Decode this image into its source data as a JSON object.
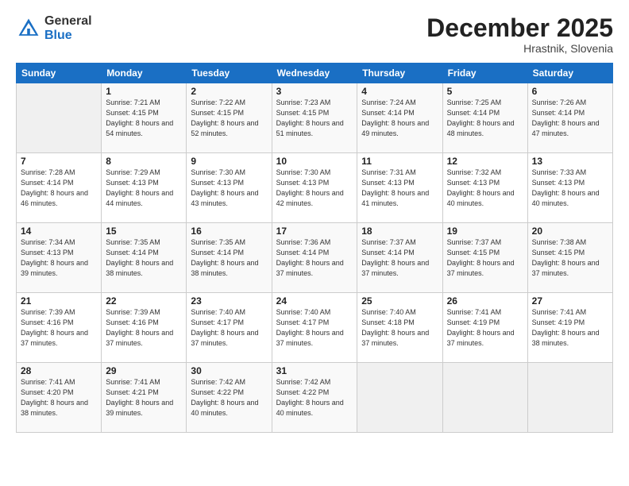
{
  "logo": {
    "general": "General",
    "blue": "Blue"
  },
  "header": {
    "month": "December 2025",
    "location": "Hrastnik, Slovenia"
  },
  "weekdays": [
    "Sunday",
    "Monday",
    "Tuesday",
    "Wednesday",
    "Thursday",
    "Friday",
    "Saturday"
  ],
  "weeks": [
    [
      {
        "day": "",
        "sunrise": "",
        "sunset": "",
        "daylight": ""
      },
      {
        "day": "1",
        "sunrise": "Sunrise: 7:21 AM",
        "sunset": "Sunset: 4:15 PM",
        "daylight": "Daylight: 8 hours and 54 minutes."
      },
      {
        "day": "2",
        "sunrise": "Sunrise: 7:22 AM",
        "sunset": "Sunset: 4:15 PM",
        "daylight": "Daylight: 8 hours and 52 minutes."
      },
      {
        "day": "3",
        "sunrise": "Sunrise: 7:23 AM",
        "sunset": "Sunset: 4:15 PM",
        "daylight": "Daylight: 8 hours and 51 minutes."
      },
      {
        "day": "4",
        "sunrise": "Sunrise: 7:24 AM",
        "sunset": "Sunset: 4:14 PM",
        "daylight": "Daylight: 8 hours and 49 minutes."
      },
      {
        "day": "5",
        "sunrise": "Sunrise: 7:25 AM",
        "sunset": "Sunset: 4:14 PM",
        "daylight": "Daylight: 8 hours and 48 minutes."
      },
      {
        "day": "6",
        "sunrise": "Sunrise: 7:26 AM",
        "sunset": "Sunset: 4:14 PM",
        "daylight": "Daylight: 8 hours and 47 minutes."
      }
    ],
    [
      {
        "day": "7",
        "sunrise": "Sunrise: 7:28 AM",
        "sunset": "Sunset: 4:14 PM",
        "daylight": "Daylight: 8 hours and 46 minutes."
      },
      {
        "day": "8",
        "sunrise": "Sunrise: 7:29 AM",
        "sunset": "Sunset: 4:13 PM",
        "daylight": "Daylight: 8 hours and 44 minutes."
      },
      {
        "day": "9",
        "sunrise": "Sunrise: 7:30 AM",
        "sunset": "Sunset: 4:13 PM",
        "daylight": "Daylight: 8 hours and 43 minutes."
      },
      {
        "day": "10",
        "sunrise": "Sunrise: 7:30 AM",
        "sunset": "Sunset: 4:13 PM",
        "daylight": "Daylight: 8 hours and 42 minutes."
      },
      {
        "day": "11",
        "sunrise": "Sunrise: 7:31 AM",
        "sunset": "Sunset: 4:13 PM",
        "daylight": "Daylight: 8 hours and 41 minutes."
      },
      {
        "day": "12",
        "sunrise": "Sunrise: 7:32 AM",
        "sunset": "Sunset: 4:13 PM",
        "daylight": "Daylight: 8 hours and 40 minutes."
      },
      {
        "day": "13",
        "sunrise": "Sunrise: 7:33 AM",
        "sunset": "Sunset: 4:13 PM",
        "daylight": "Daylight: 8 hours and 40 minutes."
      }
    ],
    [
      {
        "day": "14",
        "sunrise": "Sunrise: 7:34 AM",
        "sunset": "Sunset: 4:13 PM",
        "daylight": "Daylight: 8 hours and 39 minutes."
      },
      {
        "day": "15",
        "sunrise": "Sunrise: 7:35 AM",
        "sunset": "Sunset: 4:14 PM",
        "daylight": "Daylight: 8 hours and 38 minutes."
      },
      {
        "day": "16",
        "sunrise": "Sunrise: 7:35 AM",
        "sunset": "Sunset: 4:14 PM",
        "daylight": "Daylight: 8 hours and 38 minutes."
      },
      {
        "day": "17",
        "sunrise": "Sunrise: 7:36 AM",
        "sunset": "Sunset: 4:14 PM",
        "daylight": "Daylight: 8 hours and 37 minutes."
      },
      {
        "day": "18",
        "sunrise": "Sunrise: 7:37 AM",
        "sunset": "Sunset: 4:14 PM",
        "daylight": "Daylight: 8 hours and 37 minutes."
      },
      {
        "day": "19",
        "sunrise": "Sunrise: 7:37 AM",
        "sunset": "Sunset: 4:15 PM",
        "daylight": "Daylight: 8 hours and 37 minutes."
      },
      {
        "day": "20",
        "sunrise": "Sunrise: 7:38 AM",
        "sunset": "Sunset: 4:15 PM",
        "daylight": "Daylight: 8 hours and 37 minutes."
      }
    ],
    [
      {
        "day": "21",
        "sunrise": "Sunrise: 7:39 AM",
        "sunset": "Sunset: 4:16 PM",
        "daylight": "Daylight: 8 hours and 37 minutes."
      },
      {
        "day": "22",
        "sunrise": "Sunrise: 7:39 AM",
        "sunset": "Sunset: 4:16 PM",
        "daylight": "Daylight: 8 hours and 37 minutes."
      },
      {
        "day": "23",
        "sunrise": "Sunrise: 7:40 AM",
        "sunset": "Sunset: 4:17 PM",
        "daylight": "Daylight: 8 hours and 37 minutes."
      },
      {
        "day": "24",
        "sunrise": "Sunrise: 7:40 AM",
        "sunset": "Sunset: 4:17 PM",
        "daylight": "Daylight: 8 hours and 37 minutes."
      },
      {
        "day": "25",
        "sunrise": "Sunrise: 7:40 AM",
        "sunset": "Sunset: 4:18 PM",
        "daylight": "Daylight: 8 hours and 37 minutes."
      },
      {
        "day": "26",
        "sunrise": "Sunrise: 7:41 AM",
        "sunset": "Sunset: 4:19 PM",
        "daylight": "Daylight: 8 hours and 37 minutes."
      },
      {
        "day": "27",
        "sunrise": "Sunrise: 7:41 AM",
        "sunset": "Sunset: 4:19 PM",
        "daylight": "Daylight: 8 hours and 38 minutes."
      }
    ],
    [
      {
        "day": "28",
        "sunrise": "Sunrise: 7:41 AM",
        "sunset": "Sunset: 4:20 PM",
        "daylight": "Daylight: 8 hours and 38 minutes."
      },
      {
        "day": "29",
        "sunrise": "Sunrise: 7:41 AM",
        "sunset": "Sunset: 4:21 PM",
        "daylight": "Daylight: 8 hours and 39 minutes."
      },
      {
        "day": "30",
        "sunrise": "Sunrise: 7:42 AM",
        "sunset": "Sunset: 4:22 PM",
        "daylight": "Daylight: 8 hours and 40 minutes."
      },
      {
        "day": "31",
        "sunrise": "Sunrise: 7:42 AM",
        "sunset": "Sunset: 4:22 PM",
        "daylight": "Daylight: 8 hours and 40 minutes."
      },
      {
        "day": "",
        "sunrise": "",
        "sunset": "",
        "daylight": ""
      },
      {
        "day": "",
        "sunrise": "",
        "sunset": "",
        "daylight": ""
      },
      {
        "day": "",
        "sunrise": "",
        "sunset": "",
        "daylight": ""
      }
    ]
  ]
}
